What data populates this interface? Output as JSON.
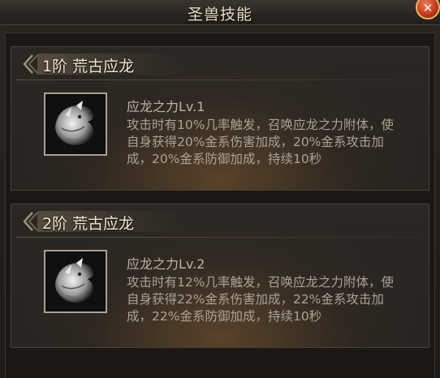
{
  "window": {
    "title": "圣兽技能",
    "close_icon": "close-x"
  },
  "tiers": [
    {
      "header": "1阶  荒古应龙",
      "skill": {
        "name": "应龙之力Lv.1",
        "description": "攻击时有10%几率触发，召唤应龙之力附体，使自身获得20%金系伤害加成，20%金系攻击加成，20%金系防御加成，持续10秒",
        "icon": "white-dragon-icon"
      }
    },
    {
      "header": "2阶  荒古应龙",
      "skill": {
        "name": "应龙之力Lv.2",
        "description": "攻击时有12%几率触发，召唤应龙之力附体，使自身获得22%金系伤害加成，22%金系攻击加成，22%金系防御加成，持续10秒",
        "icon": "white-dragon-icon"
      }
    }
  ],
  "colors": {
    "close_button": "#c63a22",
    "header_text": "#f1e6cf",
    "body_text": "#aba395"
  }
}
